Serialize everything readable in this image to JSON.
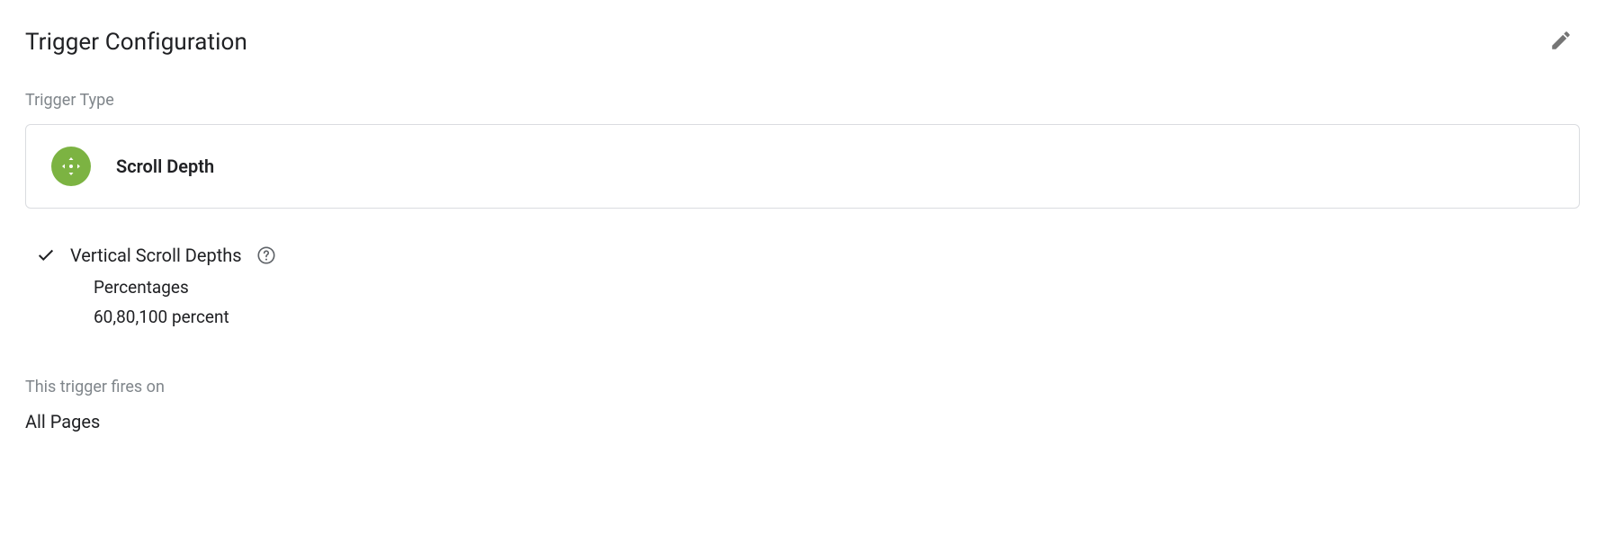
{
  "header": {
    "title": "Trigger Configuration"
  },
  "triggerType": {
    "label": "Trigger Type",
    "name": "Scroll Depth"
  },
  "scrollDepths": {
    "label": "Vertical Scroll Depths",
    "mode_label": "Percentages",
    "value": "60,80,100 percent"
  },
  "firesOn": {
    "label": "This trigger fires on",
    "value": "All Pages"
  }
}
